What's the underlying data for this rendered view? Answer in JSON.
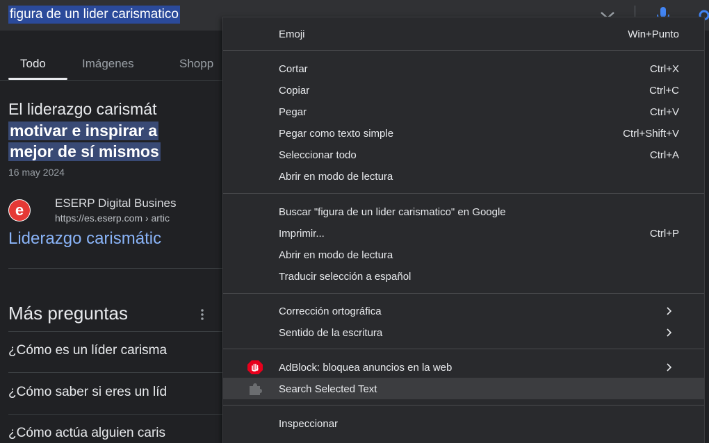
{
  "search": {
    "query": "figura de un lider carismatico",
    "icons": {
      "clear": "close-icon",
      "mic": "microphone-icon",
      "lens": "google-lens-icon"
    }
  },
  "tabs": [
    {
      "label": "Todo",
      "active": true
    },
    {
      "label": "Imágenes",
      "active": false
    },
    {
      "label": "Shopp",
      "active": false
    }
  ],
  "snippet": {
    "line1": "El liderazgo carismát",
    "line2": "motivar e inspirar a",
    "line3": "mejor de sí mismos",
    "date": "16 may 2024"
  },
  "result": {
    "favicon_letter": "e",
    "site_name": "ESERP Digital Busines",
    "url": "https://es.eserp.com › artic",
    "title": "Liderazgo carismátic"
  },
  "more_questions": {
    "title": "Más preguntas",
    "items": [
      "¿Cómo es un líder carisma",
      "¿Cómo saber si eres un líd",
      "¿Cómo actúa alguien caris"
    ]
  },
  "context_menu": {
    "items": [
      {
        "label": "Emoji",
        "shortcut": "Win+Punto"
      },
      {
        "label": "Cortar",
        "shortcut": "Ctrl+X"
      },
      {
        "label": "Copiar",
        "shortcut": "Ctrl+C"
      },
      {
        "label": "Pegar",
        "shortcut": "Ctrl+V"
      },
      {
        "label": "Pegar como texto simple",
        "shortcut": "Ctrl+Shift+V"
      },
      {
        "label": "Seleccionar todo",
        "shortcut": "Ctrl+A"
      },
      {
        "label": "Abrir en modo de lectura",
        "shortcut": ""
      },
      {
        "label": "Buscar \"figura de un lider carismatico\" en Google",
        "shortcut": ""
      },
      {
        "label": "Imprimir...",
        "shortcut": "Ctrl+P"
      },
      {
        "label": "Abrir en modo de lectura",
        "shortcut": ""
      },
      {
        "label": "Traducir selección a español",
        "shortcut": ""
      },
      {
        "label": "Corrección ortográfica",
        "shortcut": ""
      },
      {
        "label": "Sentido de la escritura",
        "shortcut": ""
      },
      {
        "label": "AdBlock: bloquea anuncios en la web",
        "shortcut": "",
        "icon": "adblock-icon"
      },
      {
        "label": "Search Selected Text",
        "shortcut": "",
        "icon": "puzzle-extension-icon"
      },
      {
        "label": "Inspeccionar",
        "shortcut": ""
      }
    ]
  },
  "colors": {
    "page_bg": "#202124",
    "menu_bg": "#292a2d",
    "selection": "#2b4a9a",
    "link": "#8ab4f8",
    "adblock_red": "#e8001c"
  }
}
